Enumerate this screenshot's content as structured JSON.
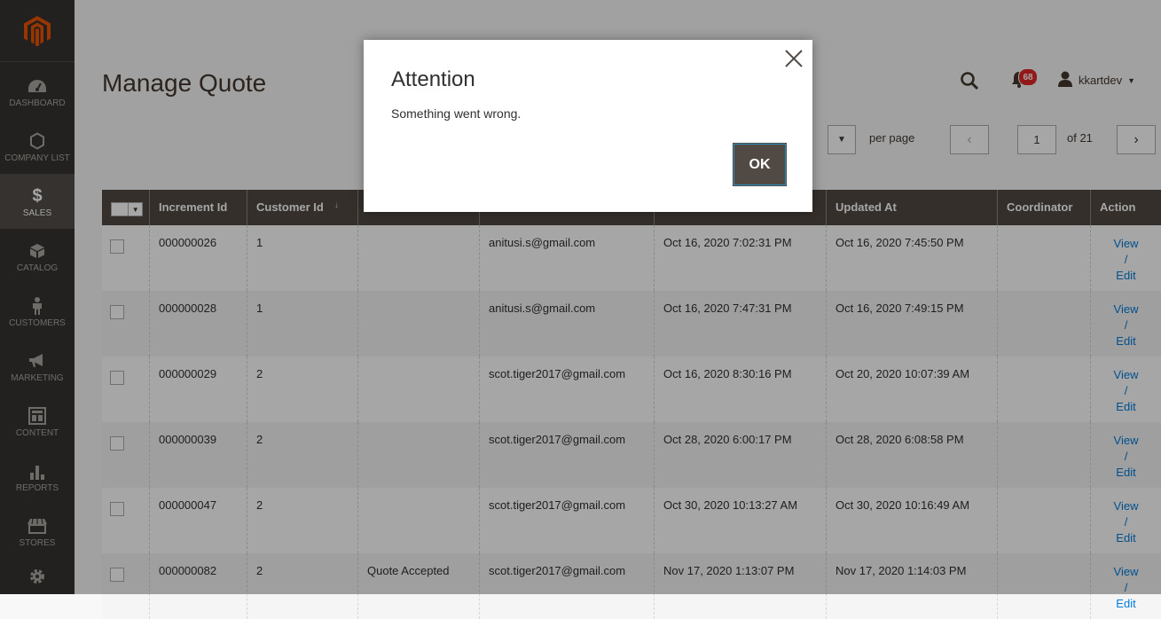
{
  "sidebar": {
    "items": [
      {
        "label": "DASHBOARD",
        "icon": "dashboard-icon"
      },
      {
        "label": "COMPANY LIST",
        "icon": "hexagon-icon"
      },
      {
        "label": "SALES",
        "icon": "dollar-icon",
        "active": true
      },
      {
        "label": "CATALOG",
        "icon": "box-icon"
      },
      {
        "label": "CUSTOMERS",
        "icon": "person-icon"
      },
      {
        "label": "MARKETING",
        "icon": "megaphone-icon"
      },
      {
        "label": "CONTENT",
        "icon": "layout-icon"
      },
      {
        "label": "REPORTS",
        "icon": "bar-chart-icon"
      },
      {
        "label": "STORES",
        "icon": "storefront-icon"
      },
      {
        "label": "",
        "icon": "gear-icon"
      }
    ]
  },
  "header": {
    "title": "Manage Quote",
    "notifications_count": "68",
    "username": "kkartdev"
  },
  "pager": {
    "per_page_label": "per page",
    "current_page": "1",
    "of_label": "of 21"
  },
  "grid": {
    "columns": [
      "Increment Id",
      "Customer Id",
      "",
      "",
      "",
      "Updated At",
      "Coordinator",
      "Action"
    ],
    "sort_glyph": "↓",
    "rows": [
      {
        "increment": "000000026",
        "customer": "1",
        "status": "",
        "email": "anitusi.s@gmail.com",
        "created": "Oct 16, 2020 7:02:31 PM",
        "updated": "Oct 16, 2020 7:45:50 PM",
        "coordinator": ""
      },
      {
        "increment": "000000028",
        "customer": "1",
        "status": "",
        "email": "anitusi.s@gmail.com",
        "created": "Oct 16, 2020 7:47:31 PM",
        "updated": "Oct 16, 2020 7:49:15 PM",
        "coordinator": ""
      },
      {
        "increment": "000000029",
        "customer": "2",
        "status": "",
        "email": "scot.tiger2017@gmail.com",
        "created": "Oct 16, 2020 8:30:16 PM",
        "updated": "Oct 20, 2020 10:07:39 AM",
        "coordinator": ""
      },
      {
        "increment": "000000039",
        "customer": "2",
        "status": "",
        "email": "scot.tiger2017@gmail.com",
        "created": "Oct 28, 2020 6:00:17 PM",
        "updated": "Oct 28, 2020 6:08:58 PM",
        "coordinator": ""
      },
      {
        "increment": "000000047",
        "customer": "2",
        "status": "",
        "email": "scot.tiger2017@gmail.com",
        "created": "Oct 30, 2020 10:13:27 AM",
        "updated": "Oct 30, 2020 10:16:49 AM",
        "coordinator": ""
      },
      {
        "increment": "000000082",
        "customer": "2",
        "status": "Quote Accepted",
        "email": "scot.tiger2017@gmail.com",
        "created": "Nov 17, 2020 1:13:07 PM",
        "updated": "Nov 17, 2020 1:14:03 PM",
        "coordinator": ""
      }
    ],
    "action_view": "View",
    "action_sep": "/",
    "action_edit": "Edit"
  },
  "modal": {
    "title": "Attention",
    "message": "Something went wrong.",
    "ok_label": "OK"
  },
  "colors": {
    "sidebar_bg": "#373330",
    "header_bg": "#514943",
    "link": "#007bdb",
    "badge": "#e22626",
    "logo": "#eb5202"
  }
}
